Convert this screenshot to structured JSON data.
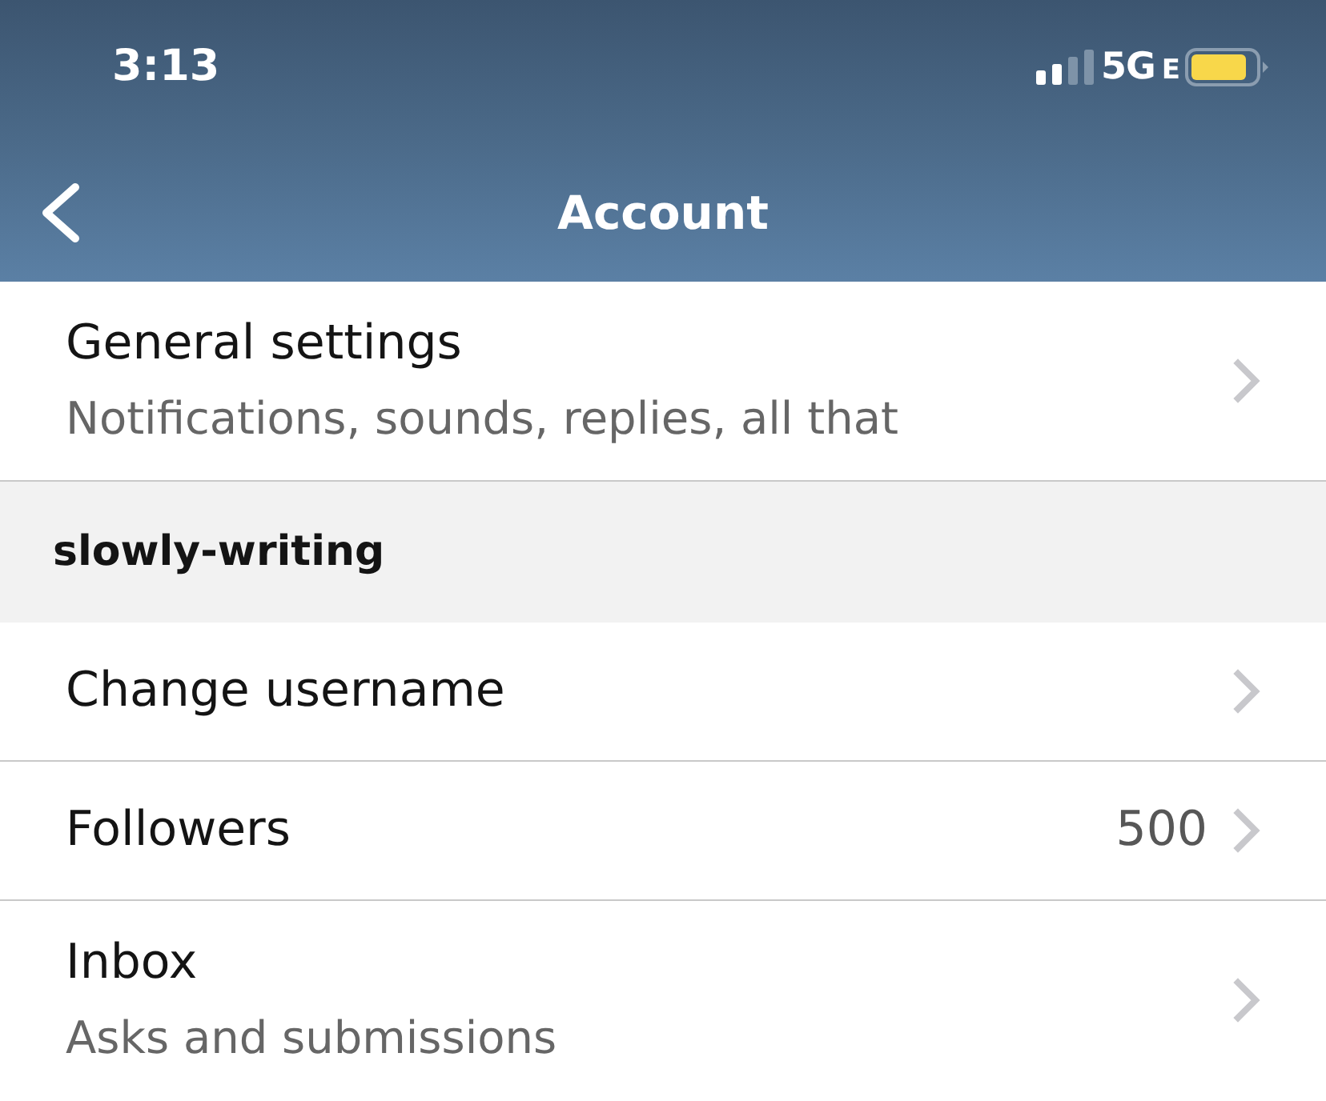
{
  "status_bar": {
    "time": "3:13",
    "network": "5G",
    "network_type": "E"
  },
  "nav_bar": {
    "title": "Account"
  },
  "rows": [
    {
      "kind": "item",
      "title": "General settings",
      "subtitle": "Notifications, sounds, replies, all that"
    },
    {
      "kind": "section",
      "title": "slowly-writing"
    },
    {
      "kind": "item",
      "title": "Change username"
    },
    {
      "kind": "item",
      "title": "Followers",
      "value": "500"
    },
    {
      "kind": "item",
      "title": "Inbox",
      "subtitle": "Asks and submissions"
    }
  ]
}
